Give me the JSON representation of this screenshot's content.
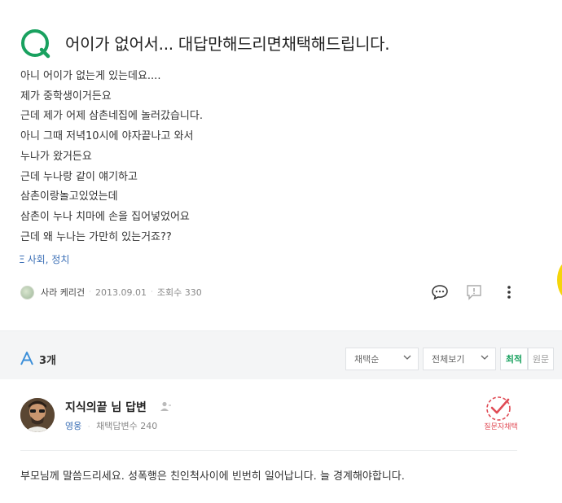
{
  "question": {
    "title": "어이가 없어서... 대답만해드리면채택해드립니다.",
    "body_lines": [
      "아니 어이가 없는게 있는데요....",
      "제가 중학생이거든요",
      "근데 제가 어제 삼촌네집에 놀러갔습니다.",
      "아니 그때 저녁10시에 야자끝나고 와서",
      "누나가 왔거든요",
      "근데 누나랑 같이 얘기하고",
      "삼촌이랑놀고있었는데",
      "삼촌이 누나 치마에 손을 집어넣었어요",
      "근데 왜 누나는 가만히 있는거죠??"
    ],
    "tag_prefix": "Ξ",
    "tags": "사회, 정치",
    "author": "사라 케리건",
    "date": "2013.09.01",
    "views": "조회수 330"
  },
  "icons": {
    "question": "question-q-icon",
    "answer": "answer-a-icon",
    "comment": "comment-icon",
    "report": "report-icon",
    "more": "more-vertical-icon",
    "user": "user-follow-icon",
    "chevron": "chevron-down-icon",
    "accept": "accept-check-icon"
  },
  "colors": {
    "brand_green": "#19a15f",
    "link_blue": "#3b6fb6",
    "accept_red": "#e04b55"
  },
  "answers_bar": {
    "count": "3개",
    "sort_select": "채택순",
    "view_select": "전체보기",
    "filter_latest": "최적",
    "filter_original": "원문"
  },
  "answer": {
    "name": "지식의끝 님 답변",
    "rank": "영웅",
    "accept_count": "채택답변수 240",
    "accept_badge": "질문자채택",
    "body": "부모님께 말씀드리세요. 성폭행은 친인척사이에 빈번히 일어납니다. 늘 경계해야합니다."
  }
}
